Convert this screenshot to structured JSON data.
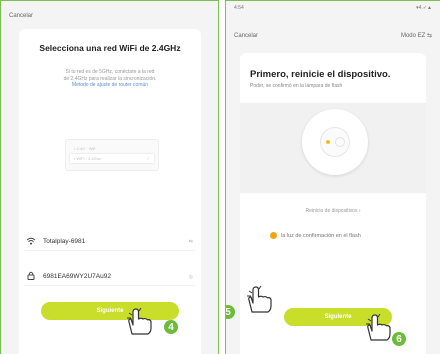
{
  "left_screen": {
    "cancel_label": "Cancelar",
    "title": "Selecciona una red WiFi de 2.4GHz",
    "hint_line1": "Si tu red es de 5GHz, conéctate a la red",
    "hint_line2": "de 2.4GHz para realizar la sincronización.",
    "hint_link": "Método de ajuste de router común",
    "mock_row1": "• 2.4G · Wifi",
    "mock_row2": "• WiFi · 2.4Ghz",
    "network_name": "Totalplay-6981",
    "network_trailing": "⇆",
    "password_value": "6981EA69WY2U7Au92",
    "password_toggle": "◎",
    "next_button": "Siguiente",
    "step_number": "4"
  },
  "right_screen": {
    "status_time": "4:54",
    "status_icons": "▾4.✓▲",
    "cancel_label": "Cancelar",
    "mode_label": "Modo EZ",
    "title": "Primero, reinicie el dispositivo.",
    "subtitle": "Poder, se confirmó en la lámpara de flash",
    "reset_link": "Reinicio de dispositivos ›",
    "confirm_label": "la luz de confirmación en el flash",
    "next_button": "Siguiente",
    "step_confirm": "5",
    "step_next": "6"
  },
  "colors": {
    "accent_button": "#c8de2b",
    "step_badge": "#6dbb3b",
    "radio_checked": "#f2a413",
    "frame_border": "#7bbf52"
  }
}
